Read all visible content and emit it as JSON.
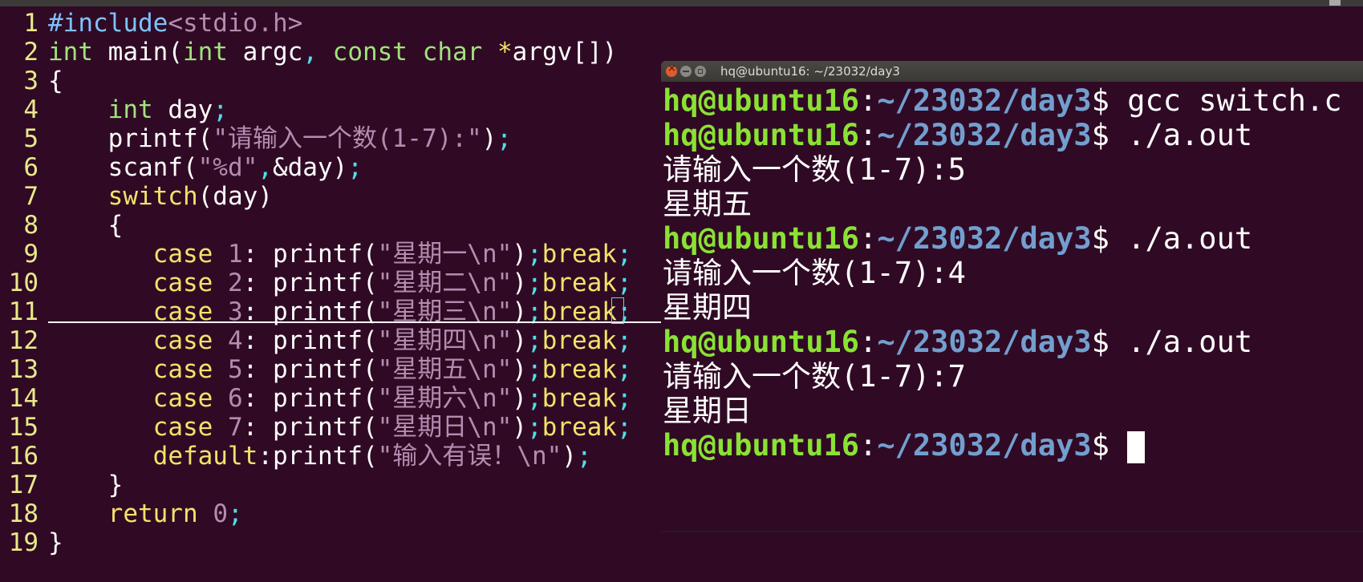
{
  "colors": {
    "background": "#300a24",
    "preprocessor": "#7dc3ff",
    "string": "#b48cb0",
    "type": "#9fe37c",
    "statement": "#f3e26b",
    "line_number": "#e9e98a",
    "prompt_user": "#8ae234",
    "prompt_path": "#729fcf"
  },
  "editor": {
    "lines": [
      {
        "n": "1",
        "parts": [
          [
            "#include",
            "kw-pre"
          ],
          [
            "<stdio.h>",
            "str"
          ]
        ]
      },
      {
        "n": "2",
        "parts": [
          [
            "int",
            "type"
          ],
          [
            " main(",
            ""
          ],
          [
            "int",
            "type"
          ],
          [
            " argc",
            ""
          ],
          [
            ",",
            "punct"
          ],
          [
            " ",
            ""
          ],
          [
            "const",
            "type"
          ],
          [
            " ",
            ""
          ],
          [
            "char",
            "type"
          ],
          [
            " ",
            ""
          ],
          [
            "*",
            "stmt"
          ],
          [
            "argv[])",
            ""
          ]
        ]
      },
      {
        "n": "3",
        "parts": [
          [
            "{",
            ""
          ]
        ]
      },
      {
        "n": "4",
        "parts": [
          [
            "    ",
            ""
          ],
          [
            "int",
            "type"
          ],
          [
            " day",
            ""
          ],
          [
            ";",
            "punct"
          ]
        ]
      },
      {
        "n": "5",
        "parts": [
          [
            "    printf(",
            ""
          ],
          [
            "\"请输入一个数(1-7):\"",
            "str"
          ],
          [
            ")",
            ""
          ],
          [
            ";",
            "punct"
          ]
        ]
      },
      {
        "n": "6",
        "parts": [
          [
            "    scanf(",
            ""
          ],
          [
            "\"%d\"",
            "str"
          ],
          [
            ",",
            "punct"
          ],
          [
            "&",
            ""
          ],
          [
            "day)",
            ""
          ],
          [
            ";",
            "punct"
          ]
        ]
      },
      {
        "n": "7",
        "parts": [
          [
            "    ",
            ""
          ],
          [
            "switch",
            "stmt"
          ],
          [
            "(day)",
            ""
          ]
        ]
      },
      {
        "n": "8",
        "parts": [
          [
            "    {",
            ""
          ]
        ]
      },
      {
        "n": "9",
        "parts": [
          [
            "       ",
            ""
          ],
          [
            "case",
            "stmt"
          ],
          [
            " ",
            ""
          ],
          [
            "1",
            "num"
          ],
          [
            ": printf(",
            ""
          ],
          [
            "\"星期一\\n\"",
            "str"
          ],
          [
            ")",
            ""
          ],
          [
            ";",
            "punct"
          ],
          [
            "break",
            "stmt"
          ],
          [
            ";",
            "punct"
          ]
        ]
      },
      {
        "n": "10",
        "parts": [
          [
            "       ",
            ""
          ],
          [
            "case",
            "stmt"
          ],
          [
            " ",
            ""
          ],
          [
            "2",
            "num"
          ],
          [
            ": printf(",
            ""
          ],
          [
            "\"星期二\\n\"",
            "str"
          ],
          [
            ")",
            ""
          ],
          [
            ";",
            "punct"
          ],
          [
            "break",
            "stmt"
          ],
          [
            ";",
            "punct"
          ]
        ]
      },
      {
        "n": "11",
        "parts": [
          [
            "       ",
            ""
          ],
          [
            "case",
            "stmt"
          ],
          [
            " ",
            ""
          ],
          [
            "3",
            "num"
          ],
          [
            ": printf(",
            ""
          ],
          [
            "\"星期三\\n\"",
            "str"
          ],
          [
            ")",
            ""
          ],
          [
            ";",
            "punct"
          ],
          [
            "break",
            "stmt"
          ],
          [
            ";",
            "punct"
          ]
        ]
      },
      {
        "n": "12",
        "parts": [
          [
            "       ",
            ""
          ],
          [
            "case",
            "stmt"
          ],
          [
            " ",
            ""
          ],
          [
            "4",
            "num"
          ],
          [
            ": printf(",
            ""
          ],
          [
            "\"星期四\\n\"",
            "str"
          ],
          [
            ")",
            ""
          ],
          [
            ";",
            "punct"
          ],
          [
            "break",
            "stmt"
          ],
          [
            ";",
            "punct"
          ]
        ]
      },
      {
        "n": "13",
        "parts": [
          [
            "       ",
            ""
          ],
          [
            "case",
            "stmt"
          ],
          [
            " ",
            ""
          ],
          [
            "5",
            "num"
          ],
          [
            ": printf(",
            ""
          ],
          [
            "\"星期五\\n\"",
            "str"
          ],
          [
            ")",
            ""
          ],
          [
            ";",
            "punct"
          ],
          [
            "break",
            "stmt"
          ],
          [
            ";",
            "punct"
          ]
        ]
      },
      {
        "n": "14",
        "parts": [
          [
            "       ",
            ""
          ],
          [
            "case",
            "stmt"
          ],
          [
            " ",
            ""
          ],
          [
            "6",
            "num"
          ],
          [
            ": printf(",
            ""
          ],
          [
            "\"星期六\\n\"",
            "str"
          ],
          [
            ")",
            ""
          ],
          [
            ";",
            "punct"
          ],
          [
            "break",
            "stmt"
          ],
          [
            ";",
            "punct"
          ]
        ]
      },
      {
        "n": "15",
        "parts": [
          [
            "       ",
            ""
          ],
          [
            "case",
            "stmt"
          ],
          [
            " ",
            ""
          ],
          [
            "7",
            "num"
          ],
          [
            ": printf(",
            ""
          ],
          [
            "\"星期日\\n\"",
            "str"
          ],
          [
            ")",
            ""
          ],
          [
            ";",
            "punct"
          ],
          [
            "break",
            "stmt"
          ],
          [
            ";",
            "punct"
          ]
        ]
      },
      {
        "n": "16",
        "parts": [
          [
            "       ",
            ""
          ],
          [
            "default",
            "stmt"
          ],
          [
            ":printf(",
            ""
          ],
          [
            "\"输入有误！\\n\"",
            "str"
          ],
          [
            ")",
            ""
          ],
          [
            ";",
            "punct"
          ]
        ]
      },
      {
        "n": "17",
        "parts": [
          [
            "    }",
            ""
          ]
        ]
      },
      {
        "n": "18",
        "parts": [
          [
            "    ",
            ""
          ],
          [
            "return",
            "stmt"
          ],
          [
            " ",
            ""
          ],
          [
            "0",
            "num"
          ],
          [
            ";",
            "punct"
          ]
        ]
      },
      {
        "n": "19",
        "parts": [
          [
            "}",
            ""
          ]
        ]
      }
    ]
  },
  "terminal": {
    "title": "hq@ubuntu16: ~/23032/day3",
    "prompt_user": "hq@ubuntu16",
    "prompt_sep": ":",
    "prompt_path": "~/23032/day3",
    "prompt_symbol": "$ ",
    "lines": [
      {
        "type": "cmd",
        "text": "gcc switch.c"
      },
      {
        "type": "cmd",
        "text": "./a.out"
      },
      {
        "type": "out",
        "text": "请输入一个数(1-7):5"
      },
      {
        "type": "out",
        "text": "星期五"
      },
      {
        "type": "cmd",
        "text": "./a.out"
      },
      {
        "type": "out",
        "text": "请输入一个数(1-7):4"
      },
      {
        "type": "out",
        "text": "星期四"
      },
      {
        "type": "cmd",
        "text": "./a.out"
      },
      {
        "type": "out",
        "text": "请输入一个数(1-7):7"
      },
      {
        "type": "out",
        "text": "星期日"
      },
      {
        "type": "cmd",
        "text": "",
        "cursor": true
      }
    ]
  }
}
